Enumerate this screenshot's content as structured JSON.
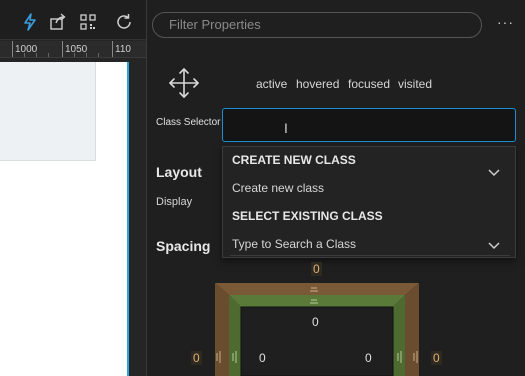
{
  "ruler": {
    "labels": [
      "1000",
      "1050",
      "110"
    ]
  },
  "panel": {
    "filter_placeholder": "Filter Properties",
    "more_label": "···",
    "states": [
      "active",
      "hovered",
      "focused",
      "visited"
    ],
    "class_selector_label": "Class Selector",
    "class_selector_value": "",
    "layout_title": "Layout",
    "display_label": "Display",
    "spacing_title": "Spacing",
    "dropdown": {
      "create_header": "CREATE NEW CLASS",
      "create_item": "Create new class",
      "select_header": "SELECT EXISTING CLASS",
      "search_placeholder": "Type to Search a Class"
    },
    "display_icons": [
      "AB",
      "AB"
    ],
    "spacing": {
      "margin_top": "0",
      "padding_top": "0",
      "margin_left": "0",
      "padding_left": "0",
      "padding_right": "0",
      "margin_right": "0"
    }
  },
  "colors": {
    "accent": "#1a8fd6",
    "margin_box": "#7a5a36",
    "padding_box": "#5a7a3a",
    "orange": "#e0b070"
  }
}
